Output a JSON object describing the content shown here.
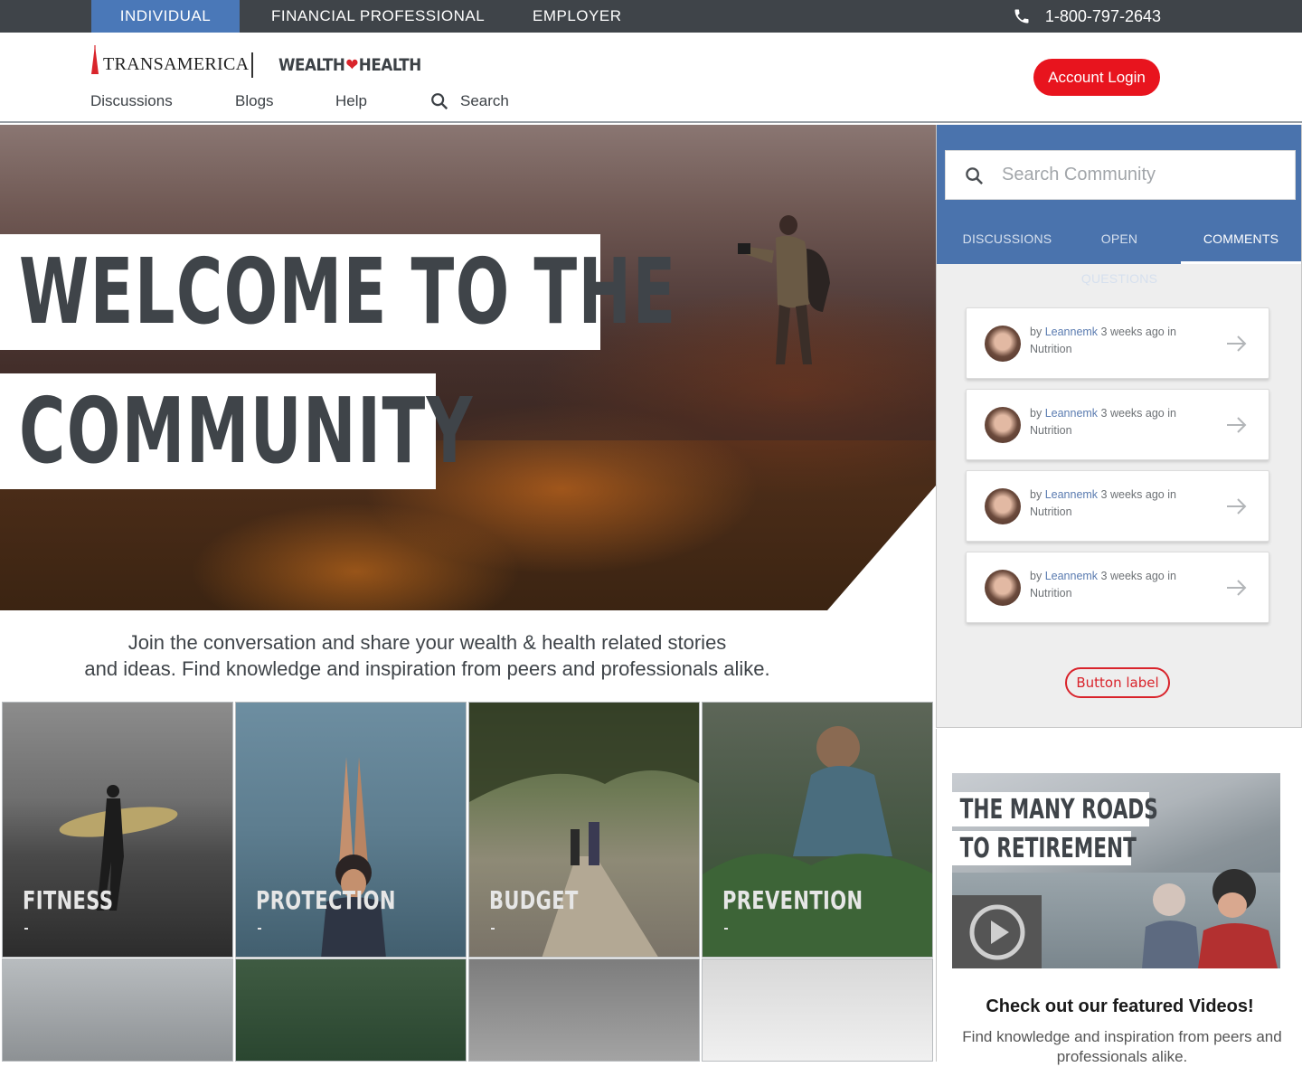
{
  "topbar": {
    "audiences": [
      "INDIVIDUAL",
      "FINANCIAL PROFESSIONAL",
      "EMPLOYER"
    ],
    "active_audience": "INDIVIDUAL",
    "phone": "1-800-797-2643"
  },
  "header": {
    "brand": "TRANSAMERICA",
    "sub_brand_left": "WEALTH",
    "sub_brand_right": "HEALTH",
    "nav": [
      "Discussions",
      "Blogs",
      "Help"
    ],
    "search_label": "Search",
    "login_label": "Account Login"
  },
  "hero": {
    "title_line1": "WELCOME TO THE",
    "title_line2": "COMMUNITY"
  },
  "intro": {
    "line1": "Join the conversation and share your wealth & health related stories",
    "line2": "and ideas. Find knowledge and inspiration from peers and professionals alike."
  },
  "categories": [
    {
      "label": "FITNESS"
    },
    {
      "label": "PROTECTION"
    },
    {
      "label": "BUDGET"
    },
    {
      "label": "PREVENTION"
    }
  ],
  "community": {
    "search_placeholder": "Search Community",
    "tabs": [
      "DISCUSSIONS",
      "OPEN QUESTIONS",
      "COMMENTS"
    ],
    "active_tab": "COMMENTS",
    "comments": [
      {
        "by": "by",
        "user": "Leannemk",
        "when": "3 weeks ago in",
        "category": "Nutrition"
      },
      {
        "by": "by",
        "user": "Leannemk",
        "when": "3 weeks ago in",
        "category": "Nutrition"
      },
      {
        "by": "by",
        "user": "Leannemk",
        "when": "3 weeks ago in",
        "category": "Nutrition"
      },
      {
        "by": "by",
        "user": "Leannemk",
        "when": "3 weeks ago in",
        "category": "Nutrition"
      }
    ],
    "button_label": "Button label"
  },
  "featured": {
    "video_title_line1": "THE MANY ROADS",
    "video_title_line2": "TO RETIREMENT",
    "heading": "Check out our featured Videos!",
    "text": "Find knowledge and inspiration from peers and professionals alike."
  },
  "colors": {
    "topbar": "#3f4449",
    "active_audience": "#4a78b8",
    "login_red": "#e8141e",
    "community_blue": "#4a73ad"
  }
}
